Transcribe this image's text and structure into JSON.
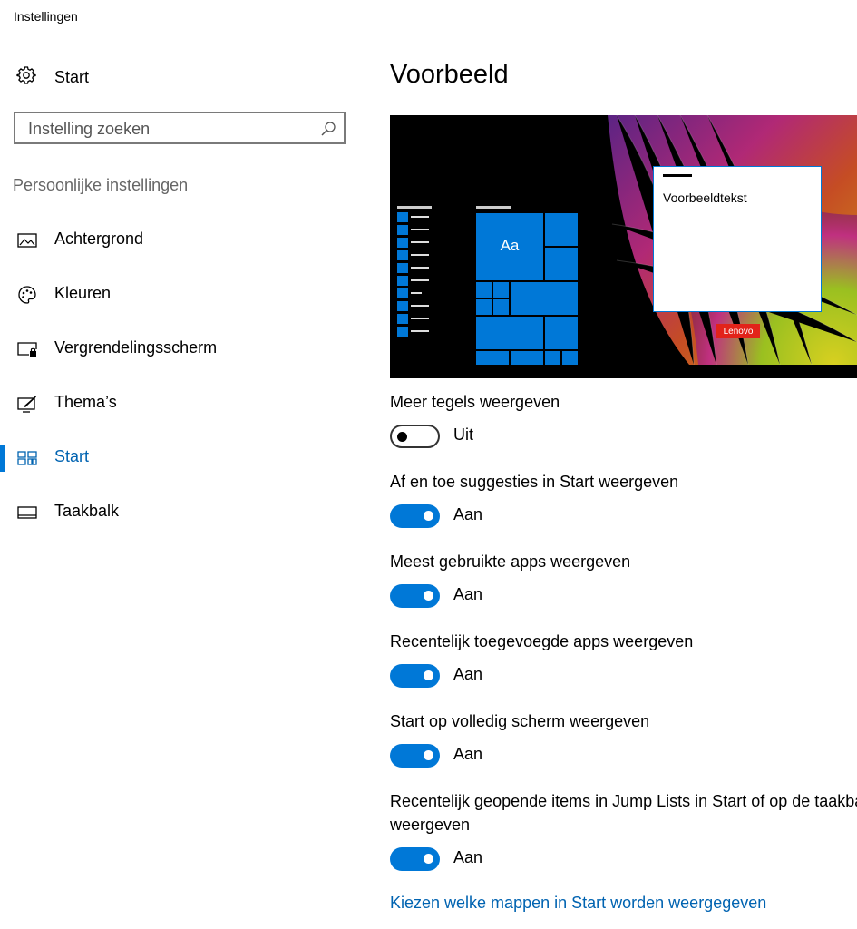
{
  "window": {
    "title": "Instellingen"
  },
  "sidebar": {
    "home_label": "Start",
    "search": {
      "placeholder": "Instelling zoeken"
    },
    "section_title": "Persoonlijke instellingen",
    "items": [
      {
        "label": "Achtergrond",
        "icon": "picture-icon",
        "active": false
      },
      {
        "label": "Kleuren",
        "icon": "palette-icon",
        "active": false
      },
      {
        "label": "Vergrendelingsscherm",
        "icon": "lock-screen-icon",
        "active": false
      },
      {
        "label": "Thema’s",
        "icon": "themes-icon",
        "active": false
      },
      {
        "label": "Start",
        "icon": "start-tiles-icon",
        "active": true
      },
      {
        "label": "Taakbalk",
        "icon": "taskbar-icon",
        "active": false
      }
    ]
  },
  "main": {
    "title": "Voorbeeld",
    "preview": {
      "window_text": "Voorbeeldtekst",
      "tile_text": "Aa",
      "logo_text": "Lenovo"
    },
    "settings": [
      {
        "label": "Meer tegels weergeven",
        "state": "Uit",
        "on": false
      },
      {
        "label": "Af en toe suggesties in Start weergeven",
        "state": "Aan",
        "on": true
      },
      {
        "label": "Meest gebruikte apps weergeven",
        "state": "Aan",
        "on": true
      },
      {
        "label": "Recentelijk toegevoegde apps weergeven",
        "state": "Aan",
        "on": true
      },
      {
        "label": "Start op volledig scherm weergeven",
        "state": "Aan",
        "on": true
      },
      {
        "label": "Recentelijk geopende items in Jump Lists in Start of op de taakbalk",
        "label_line2": "weergeven",
        "state": "Aan",
        "on": true
      }
    ],
    "link": "Kiezen welke mappen in Start worden weergegeven"
  },
  "colors": {
    "accent": "#0078d7",
    "link": "#0063b1",
    "toggle_off_border": "#333333"
  }
}
